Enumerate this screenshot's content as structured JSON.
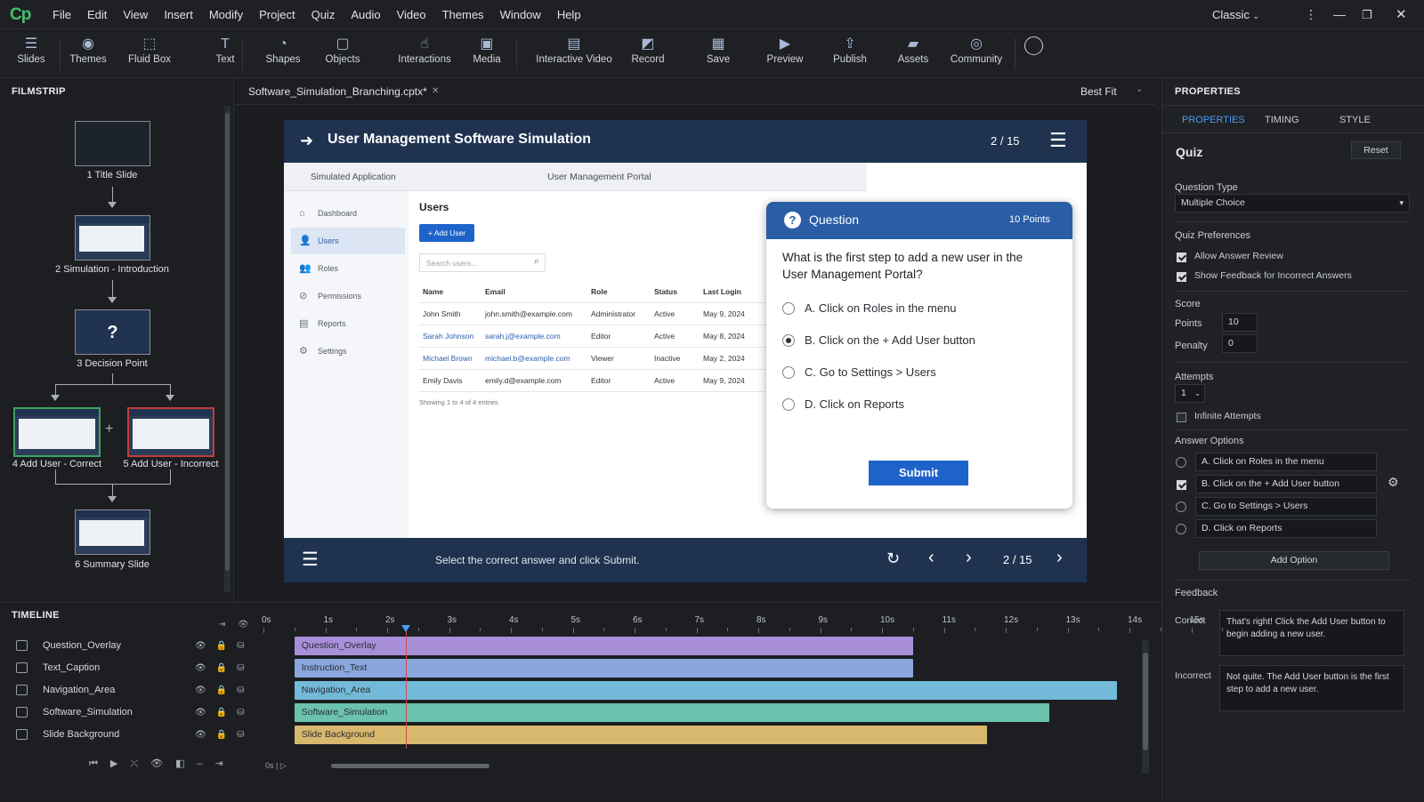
{
  "menubar": {
    "logo": "Cp",
    "items": [
      "File",
      "Edit",
      "View",
      "Insert",
      "Modify",
      "Project",
      "Quiz",
      "Audio",
      "Video",
      "Themes",
      "Window",
      "Help"
    ],
    "workspace": "Classic"
  },
  "toolbar": {
    "tools": [
      {
        "label": "Slides",
        "icon": "slides-icon",
        "glyph": "☰"
      },
      {
        "label": "Themes",
        "icon": "themes-icon",
        "glyph": "◉"
      },
      {
        "label": "Fluid Box",
        "icon": "fluid-box-icon",
        "glyph": "⬚"
      },
      {
        "label": "Text",
        "icon": "text-icon",
        "glyph": "T"
      },
      {
        "label": "Shapes",
        "icon": "shapes-icon",
        "glyph": "◔"
      },
      {
        "label": "Objects",
        "icon": "objects-icon",
        "glyph": "▢"
      },
      {
        "label": "Interactions",
        "icon": "interactions-icon",
        "glyph": "☝"
      },
      {
        "label": "Media",
        "icon": "media-icon",
        "glyph": "▣"
      },
      {
        "label": "Interactive Video",
        "icon": "interactive-video-icon",
        "glyph": "▤"
      },
      {
        "label": "Record",
        "icon": "record-icon",
        "glyph": "◩"
      },
      {
        "label": "Save",
        "icon": "save-icon",
        "glyph": "▦"
      },
      {
        "label": "Preview",
        "icon": "preview-icon",
        "glyph": "▶"
      },
      {
        "label": "Publish",
        "icon": "publish-icon",
        "glyph": "⇪"
      },
      {
        "label": "Assets",
        "icon": "assets-icon",
        "glyph": "▰"
      },
      {
        "label": "Community",
        "icon": "community-icon",
        "glyph": "◎"
      }
    ]
  },
  "filmstrip": {
    "title": "FILMSTRIP",
    "slides": [
      {
        "label": "1 Title Slide"
      },
      {
        "label": "2 Simulation - Introduction"
      },
      {
        "label": "3 Decision Point",
        "glyph": "?"
      },
      {
        "label": "4 Add User - Correct"
      },
      {
        "label": "5 Add User - Incorrect"
      },
      {
        "label": "6 Summary Slide"
      }
    ]
  },
  "document": {
    "tab": "Software_Simulation_Branching.cptx*",
    "zoom": "Best Fit"
  },
  "slide": {
    "title": "User Management Software Simulation",
    "counter": "2 / 15",
    "app": {
      "sim_label": "Simulated Application",
      "portal": "User Management Portal",
      "nav": [
        "Dashboard",
        "Users",
        "Roles",
        "Permissions",
        "Reports",
        "Settings"
      ],
      "heading": "Users",
      "add_button": "+ Add User",
      "search_placeholder": "Search users...",
      "columns": [
        "Name",
        "Email",
        "Role",
        "Status",
        "Last Login"
      ],
      "rows": [
        [
          "John Smith",
          "john.smith@example.com",
          "Administrator",
          "Active",
          "May 9, 2024"
        ],
        [
          "Sarah Johnson",
          "sarah.j@example.com",
          "Editor",
          "Active",
          "May 8, 2024"
        ],
        [
          "Michael Brown",
          "michael.b@example.com",
          "Viewer",
          "Inactive",
          "May 2, 2024"
        ],
        [
          "Emily Davis",
          "emily.d@example.com",
          "Editor",
          "Active",
          "May 9, 2024"
        ]
      ],
      "showing": "Showing 1 to 4 of 4 entries"
    },
    "footer": {
      "instruction": "Select the correct answer and click Submit.",
      "counter": "2 / 15"
    },
    "question": {
      "header": "Question",
      "points": "10 Points",
      "text": "What is the first step to add a new user in the User Management Portal?",
      "options": [
        "A. Click on Roles in the menu",
        "B. Click on the + Add User button",
        "C. Go to Settings > Users",
        "D. Click on Reports"
      ],
      "submit": "Submit"
    }
  },
  "properties": {
    "title": "PROPERTIES",
    "tabs": [
      "PROPERTIES",
      "TIMING",
      "STYLE"
    ],
    "section": "Quiz",
    "reset": "Reset",
    "question_type_label": "Question Type",
    "question_type": "Multiple Choice",
    "prefs_label": "Quiz Preferences",
    "allow_review": "Allow Answer Review",
    "show_feedback": "Show Feedback for Incorrect Answers",
    "score_label": "Score",
    "points_label": "Points",
    "points": "10",
    "penalty_label": "Penalty",
    "penalty": "0",
    "attempts_label": "Attempts",
    "attempts": "1",
    "infinite": "Infinite Attempts",
    "answer_options_label": "Answer Options",
    "answers": [
      "A. Click on Roles in the menu",
      "B. Click on the + Add User button",
      "C. Go to Settings > Users",
      "D. Click on Reports"
    ],
    "add_option": "Add Option",
    "feedback_label": "Feedback",
    "correct_label": "Correct",
    "correct_text": "That's right! Click the Add User button to begin adding a new user.",
    "incorrect_label": "Incorrect",
    "incorrect_text": "Not quite. The Add User button is the first step to add a new user."
  },
  "timeline": {
    "title": "TIMELINE",
    "ticks": [
      "0s",
      "1s",
      "2s",
      "3s",
      "4s",
      "5s",
      "6s",
      "7s",
      "8s",
      "9s",
      "10s",
      "11s",
      "12s",
      "13s",
      "14s",
      "15s"
    ],
    "layers": [
      {
        "name": "Question_Overlay",
        "bar": "Question_Overlay",
        "start": 0.5,
        "end": 10.5,
        "color": "#a98fd8"
      },
      {
        "name": "Text_Caption",
        "bar": "Instruction_Text",
        "start": 0.5,
        "end": 10.5,
        "color": "#8aa6dc"
      },
      {
        "name": "Navigation_Area",
        "bar": "Navigation_Area",
        "start": 0.5,
        "end": 13.8,
        "color": "#73b9d9"
      },
      {
        "name": "Software_Simulation",
        "bar": "Software_Simulation",
        "start": 0.5,
        "end": 12.7,
        "color": "#6bc2ae"
      },
      {
        "name": "Slide Background",
        "bar": "Slide Background",
        "start": 0.5,
        "end": 11.7,
        "color": "#d8b86d"
      }
    ],
    "playhead": 2.3
  },
  "colors": {
    "accent": "#4d9cf0",
    "slide_header": "#1f3350",
    "question_header": "#2a5da6",
    "submit": "#1e63c9"
  }
}
